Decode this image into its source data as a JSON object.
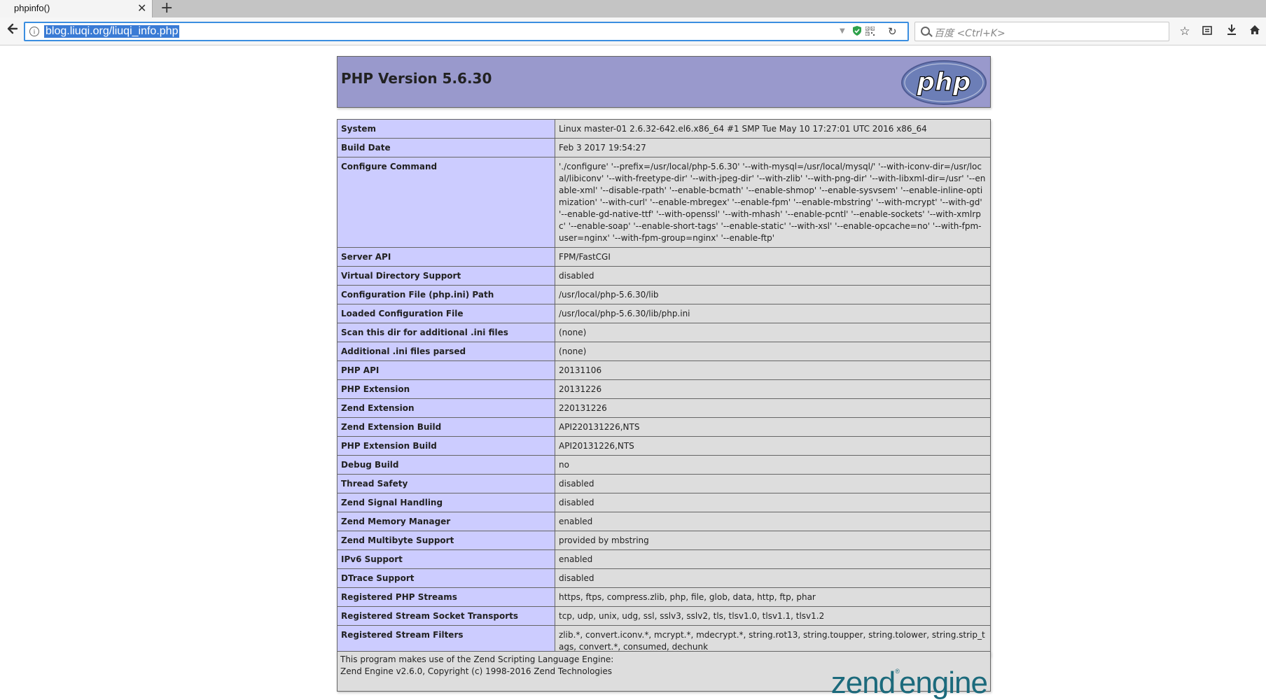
{
  "browser": {
    "tab_title": "phpinfo()",
    "tab_close": "✕",
    "new_tab": "+",
    "url": "blog.liuqi.org/liuqi_info.php",
    "search_placeholder": "百度 <Ctrl+K>",
    "icons": [
      "back-arrow-icon",
      "info-icon",
      "dropdown-icon",
      "shield-icon",
      "qr-code-icon",
      "reload-icon",
      "search-icon",
      "star-icon",
      "reader-icon",
      "download-icon",
      "home-icon"
    ]
  },
  "header": {
    "title": "PHP Version 5.6.30",
    "logo_text": "php"
  },
  "rows": [
    {
      "key": "System",
      "value": "Linux master-01 2.6.32-642.el6.x86_64 #1 SMP Tue May 10 17:27:01 UTC 2016 x86_64"
    },
    {
      "key": "Build Date",
      "value": "Feb 3 2017 19:54:27"
    },
    {
      "key": "Configure Command",
      "value": "'./configure' '--prefix=/usr/local/php-5.6.30' '--with-mysql=/usr/local/mysql/' '--with-iconv-dir=/usr/local/libiconv' '--with-freetype-dir' '--with-jpeg-dir' '--with-zlib' '--with-png-dir' '--with-libxml-dir=/usr' '--enable-xml' '--disable-rpath' '--enable-bcmath' '--enable-shmop' '--enable-sysvsem' '--enable-inline-optimization' '--with-curl' '--enable-mbregex' '--enable-fpm' '--enable-mbstring' '--with-mcrypt' '--with-gd' '--enable-gd-native-ttf' '--with-openssl' '--with-mhash' '--enable-pcntl' '--enable-sockets' '--with-xmlrpc' '--enable-soap' '--enable-short-tags' '--enable-static' '--with-xsl' '--enable-opcache=no' '--with-fpm-user=nginx' '--with-fpm-group=nginx' '--enable-ftp'"
    },
    {
      "key": "Server API",
      "value": "FPM/FastCGI"
    },
    {
      "key": "Virtual Directory Support",
      "value": "disabled"
    },
    {
      "key": "Configuration File (php.ini) Path",
      "value": "/usr/local/php-5.6.30/lib"
    },
    {
      "key": "Loaded Configuration File",
      "value": "/usr/local/php-5.6.30/lib/php.ini"
    },
    {
      "key": "Scan this dir for additional .ini files",
      "value": "(none)"
    },
    {
      "key": "Additional .ini files parsed",
      "value": "(none)"
    },
    {
      "key": "PHP API",
      "value": "20131106"
    },
    {
      "key": "PHP Extension",
      "value": "20131226"
    },
    {
      "key": "Zend Extension",
      "value": "220131226"
    },
    {
      "key": "Zend Extension Build",
      "value": "API220131226,NTS"
    },
    {
      "key": "PHP Extension Build",
      "value": "API20131226,NTS"
    },
    {
      "key": "Debug Build",
      "value": "no"
    },
    {
      "key": "Thread Safety",
      "value": "disabled"
    },
    {
      "key": "Zend Signal Handling",
      "value": "disabled"
    },
    {
      "key": "Zend Memory Manager",
      "value": "enabled"
    },
    {
      "key": "Zend Multibyte Support",
      "value": "provided by mbstring"
    },
    {
      "key": "IPv6 Support",
      "value": "enabled"
    },
    {
      "key": "DTrace Support",
      "value": "disabled"
    },
    {
      "key": "Registered PHP Streams",
      "value": "https, ftps, compress.zlib, php, file, glob, data, http, ftp, phar"
    },
    {
      "key": "Registered Stream Socket Transports",
      "value": "tcp, udp, unix, udg, ssl, sslv3, sslv2, tls, tlsv1.0, tlsv1.1, tlsv1.2"
    },
    {
      "key": "Registered Stream Filters",
      "value": "zlib.*, convert.iconv.*, mcrypt.*, mdecrypt.*, string.rot13, string.toupper, string.tolower, string.strip_tags, convert.*, consumed, dechunk"
    }
  ],
  "zend": {
    "line1": "This program makes use of the Zend Scripting Language Engine:",
    "line2": "Zend Engine v2.6.0, Copyright (c) 1998-2016 Zend Technologies",
    "logo_word1": "zend",
    "logo_mark": "®",
    "logo_word2": "engine"
  }
}
